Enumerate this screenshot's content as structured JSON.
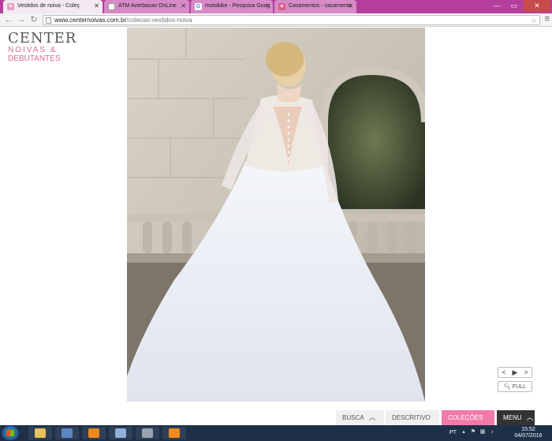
{
  "browser": {
    "tabs": [
      {
        "title": "Vestidos de noiva - Coleç",
        "icon": "heart-icon",
        "active": true
      },
      {
        "title": "ATM Averbacao OnLine",
        "icon": "page-icon",
        "active": false
      },
      {
        "title": "motobike - Pesquisa Goog",
        "icon": "google-icon",
        "active": false
      },
      {
        "title": "Casamentos - casamento",
        "icon": "heart-icon",
        "active": false
      }
    ],
    "url_host": "www.centernoivas.com.br",
    "url_path": "/colecao-vestidos-noiva"
  },
  "logo": {
    "line1": "CENTER",
    "line2": "NOIVAS &",
    "line3": "DEBUTANTES",
    "brand_color": "#d86a9a"
  },
  "gallery": {
    "prev_label": "<",
    "play_label": "▶",
    "next_label": ">",
    "full_label": "FULL"
  },
  "bottom_tabs": {
    "busca": "BUSCA",
    "descritivo": "DESCRITIVO",
    "colecoes": "COLEÇÕES",
    "menu": "MENU",
    "accent_color": "#f27aa7"
  },
  "taskbar": {
    "lang": "PT",
    "time": "15:52",
    "date": "04/07/2016"
  }
}
